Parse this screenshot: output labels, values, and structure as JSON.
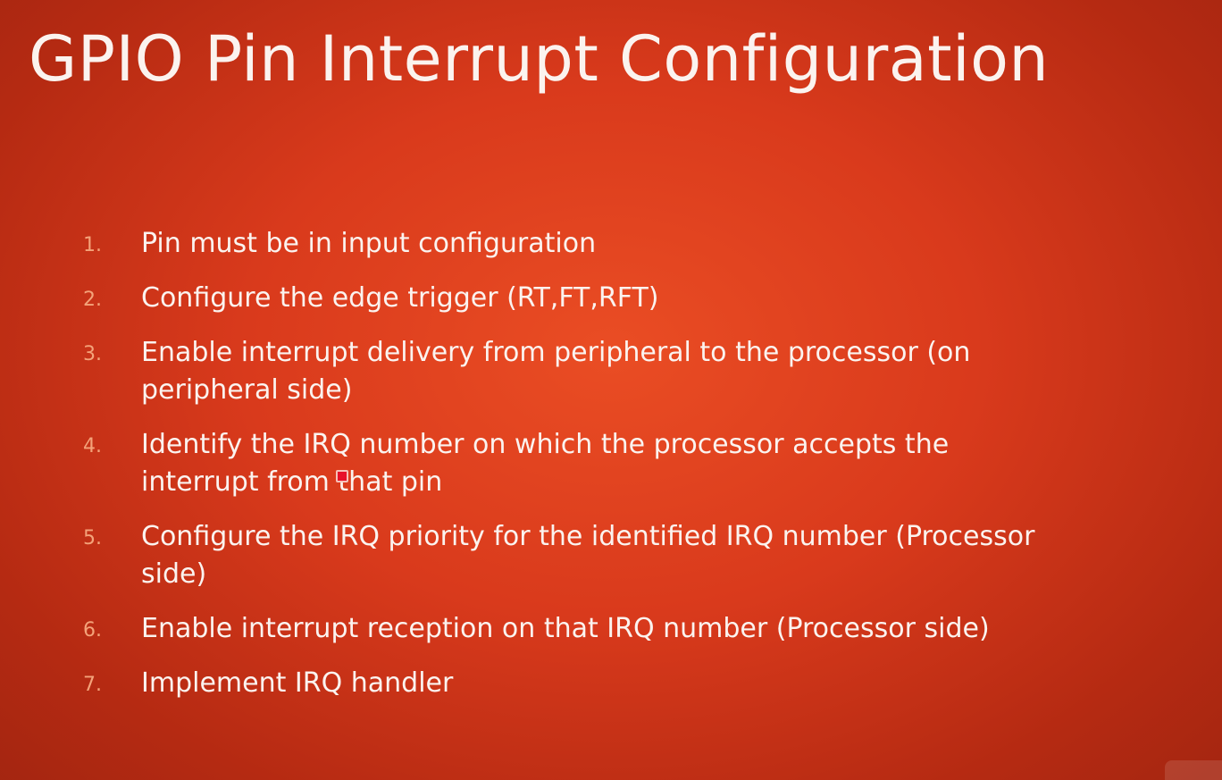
{
  "slide": {
    "title": "GPIO Pin Interrupt Configuration",
    "items": [
      {
        "number": "1.",
        "lines": [
          "Pin must be in input configuration"
        ]
      },
      {
        "number": "2.",
        "lines": [
          "Configure the edge trigger (RT,FT,RFT)"
        ]
      },
      {
        "number": "3.",
        "lines": [
          "Enable interrupt delivery  from peripheral to the processor (on",
          "peripheral side)"
        ]
      },
      {
        "number": "4.",
        "lines": [
          "Identify the IRQ number on which the processor accepts the",
          "interrupt from that pin"
        ]
      },
      {
        "number": "5.",
        "lines": [
          "Configure the IRQ priority for the identified IRQ number (Processor",
          "side)"
        ]
      },
      {
        "number": "6.",
        "lines": [
          "Enable interrupt reception on that IRQ number (Processor side)"
        ]
      },
      {
        "number": "7.",
        "lines": [
          "Implement IRQ handler"
        ]
      }
    ]
  },
  "colors": {
    "background": "#d93a1c",
    "text": "#fbf3ef",
    "numbers": "#f4a37a",
    "pointer": "#e8102a"
  },
  "icons": {
    "pointer": "red-square-pointer"
  }
}
